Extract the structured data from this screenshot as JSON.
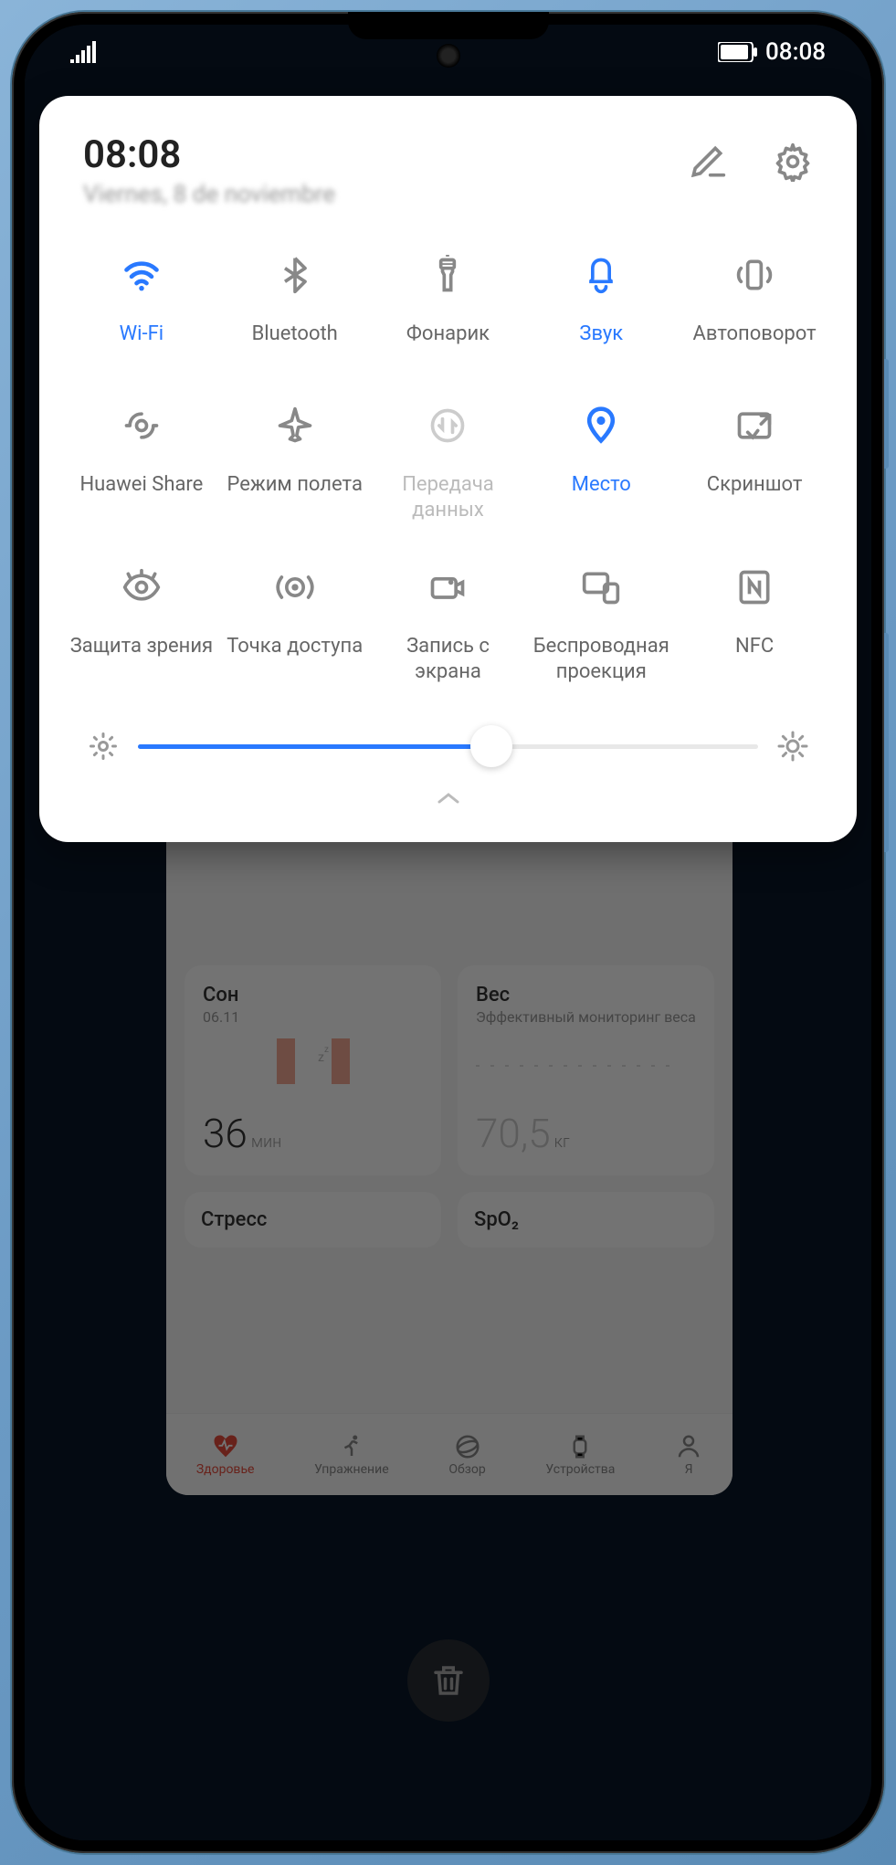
{
  "status": {
    "time": "08:08"
  },
  "panel": {
    "time": "08:08",
    "date": "Viernes, 8 de noviembre"
  },
  "tiles": [
    {
      "label": "Wi-Fi",
      "icon": "wifi",
      "state": "active"
    },
    {
      "label": "Bluetooth",
      "icon": "bluetooth",
      "state": "normal"
    },
    {
      "label": "Фонарик",
      "icon": "flashlight",
      "state": "normal"
    },
    {
      "label": "Звук",
      "icon": "sound",
      "state": "active"
    },
    {
      "label": "Автоповорот",
      "icon": "autorotate",
      "state": "normal"
    },
    {
      "label": "Huawei Share",
      "icon": "share",
      "state": "normal"
    },
    {
      "label": "Режим полета",
      "icon": "airplane",
      "state": "normal"
    },
    {
      "label": "Передача данных",
      "icon": "data",
      "state": "disabled"
    },
    {
      "label": "Место",
      "icon": "location",
      "state": "active"
    },
    {
      "label": "Скриншот",
      "icon": "screenshot",
      "state": "normal"
    },
    {
      "label": "Защита зрения",
      "icon": "eye",
      "state": "normal"
    },
    {
      "label": "Точка доступа",
      "icon": "hotspot",
      "state": "normal"
    },
    {
      "label": "Запись с экрана",
      "icon": "record",
      "state": "normal"
    },
    {
      "label": "Беспроводная проекция",
      "icon": "cast",
      "state": "normal"
    },
    {
      "label": "NFC",
      "icon": "nfc",
      "state": "normal"
    }
  ],
  "brightness": {
    "value": 57
  },
  "health": {
    "sleep": {
      "title": "Сон",
      "date": "06.11",
      "value": "36",
      "unit": "мин"
    },
    "weight": {
      "title": "Вес",
      "sub": "Эффективный мониторинг веса",
      "value": "70,5",
      "unit": "кг"
    },
    "stress": {
      "title": "Стресс"
    },
    "spo2": {
      "title": "SpO₂"
    }
  },
  "nav": [
    {
      "label": "Здоровье",
      "active": true
    },
    {
      "label": "Упражнение",
      "active": false
    },
    {
      "label": "Обзор",
      "active": false
    },
    {
      "label": "Устройства",
      "active": false
    },
    {
      "label": "Я",
      "active": false
    }
  ]
}
